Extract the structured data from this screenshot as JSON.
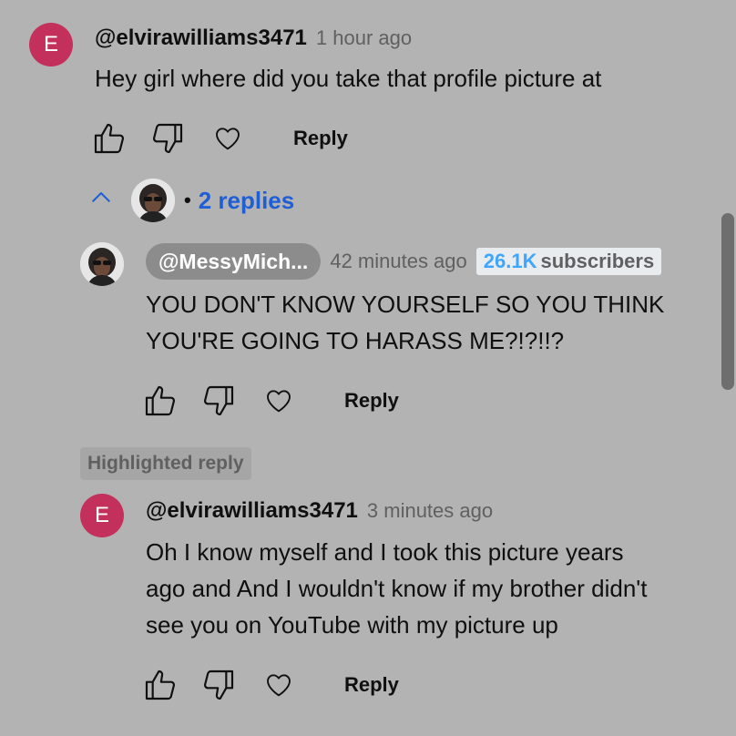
{
  "comment_top": {
    "avatar_letter": "E",
    "handle": "@elvirawilliams3471",
    "time": "1 hour ago",
    "text": "Hey girl where did you take that profile picture at",
    "reply_label": "Reply"
  },
  "replies_toggle": {
    "label": "2 replies"
  },
  "reply_creator": {
    "handle": "@MessyMich...",
    "time": "42 minutes ago",
    "sub_count": "26.1K",
    "sub_word": "subscribers",
    "text_line1": "YOU DON'T KNOW YOURSELF SO YOU THINK",
    "text_line2": "YOU'RE GOING TO HARASS ME?!?!!?",
    "reply_label": "Reply"
  },
  "highlighted": {
    "label": "Highlighted reply"
  },
  "reply_user": {
    "avatar_letter": "E",
    "handle": "@elvirawilliams3471",
    "time": "3 minutes ago",
    "text_line1": "Oh I know myself and I took this picture years",
    "text_line2": "ago and And I wouldn't know if my brother didn't",
    "text_line3": "see you on YouTube with my picture up",
    "reply_label": "Reply"
  },
  "colors": {
    "background": "#b3b3b3",
    "avatar_bg": "#c2305b",
    "link_blue": "#1f5fd6",
    "sub_blue": "#3ea6ff"
  }
}
